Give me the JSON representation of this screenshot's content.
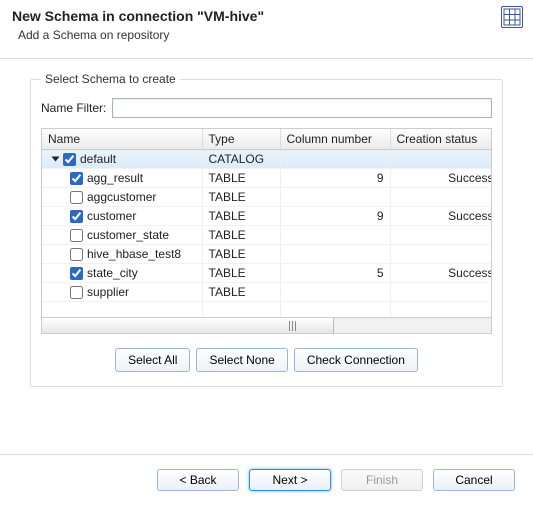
{
  "header": {
    "title": "New Schema in connection \"VM-hive\"",
    "subtitle": "Add a Schema on repository"
  },
  "section": {
    "label": "Select Schema to create",
    "filter_label": "Name Filter:",
    "filter_value": ""
  },
  "table": {
    "columns": {
      "name": "Name",
      "type": "Type",
      "num": "Column number",
      "status": "Creation status"
    },
    "root": {
      "name": "default",
      "type": "CATALOG",
      "checked": true,
      "expanded": true
    },
    "rows": [
      {
        "name": "agg_result",
        "type": "TABLE",
        "checked": true,
        "num": "9",
        "status": "Success"
      },
      {
        "name": "aggcustomer",
        "type": "TABLE",
        "checked": false,
        "num": "",
        "status": ""
      },
      {
        "name": "customer",
        "type": "TABLE",
        "checked": true,
        "num": "9",
        "status": "Success"
      },
      {
        "name": "customer_state",
        "type": "TABLE",
        "checked": false,
        "num": "",
        "status": ""
      },
      {
        "name": "hive_hbase_test8",
        "type": "TABLE",
        "checked": false,
        "num": "",
        "status": ""
      },
      {
        "name": "state_city",
        "type": "TABLE",
        "checked": true,
        "num": "5",
        "status": "Success"
      },
      {
        "name": "supplier",
        "type": "TABLE",
        "checked": false,
        "num": "",
        "status": ""
      }
    ]
  },
  "buttons": {
    "select_all": "Select All",
    "select_none": "Select None",
    "check_conn": "Check Connection",
    "back": "< Back",
    "next": "Next >",
    "finish": "Finish",
    "cancel": "Cancel"
  }
}
